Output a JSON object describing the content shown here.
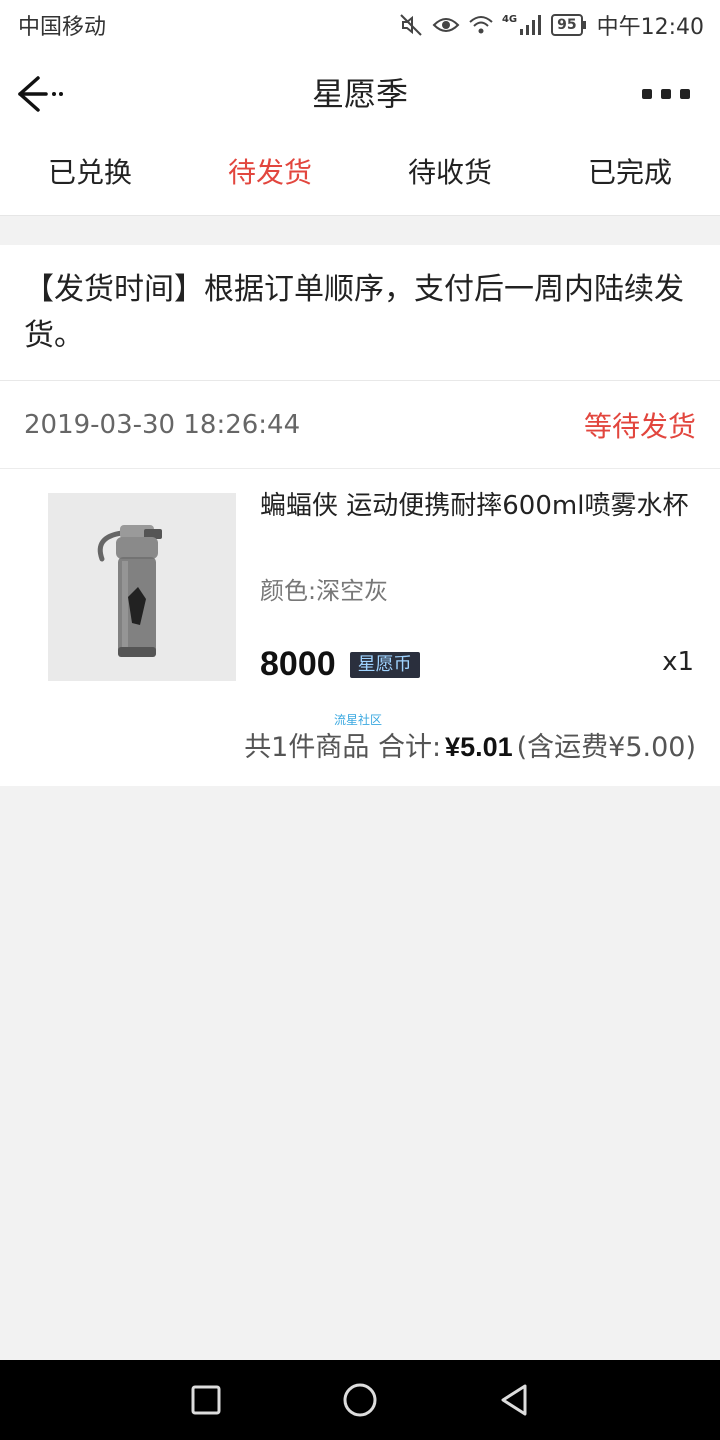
{
  "status_bar": {
    "carrier": "中国移动",
    "network": "4G",
    "battery": "95",
    "time": "中午12:40"
  },
  "nav": {
    "title": "星愿季"
  },
  "tabs": [
    {
      "label": "已兑换"
    },
    {
      "label": "待发货"
    },
    {
      "label": "待收货"
    },
    {
      "label": "已完成"
    }
  ],
  "notice": {
    "text": "【发货时间】根据订单顺序，支付后一周内陆续发货。"
  },
  "order": {
    "time": "2019-03-30 18:26:44",
    "status": "等待发货",
    "product": {
      "name": "蝙蝠侠 运动便携耐摔600ml喷雾水杯",
      "spec": "颜色:深空灰",
      "price": "8000",
      "currency_badge": "星愿币",
      "quantity": "x1"
    },
    "watermark": "流星社区",
    "summary": {
      "count_text": "共1件商品 合计:",
      "total": "¥5.01",
      "shipping": "(含运费¥5.00)"
    }
  },
  "colors": {
    "accent_red": "#e2463e",
    "badge_bg": "#2a2f3d"
  },
  "icons": [
    "back-arrow-icon",
    "more-icon",
    "mute-icon",
    "eye-icon",
    "wifi-icon",
    "signal-icon",
    "battery-icon",
    "recent-apps-icon",
    "home-icon",
    "back-triangle-icon"
  ]
}
